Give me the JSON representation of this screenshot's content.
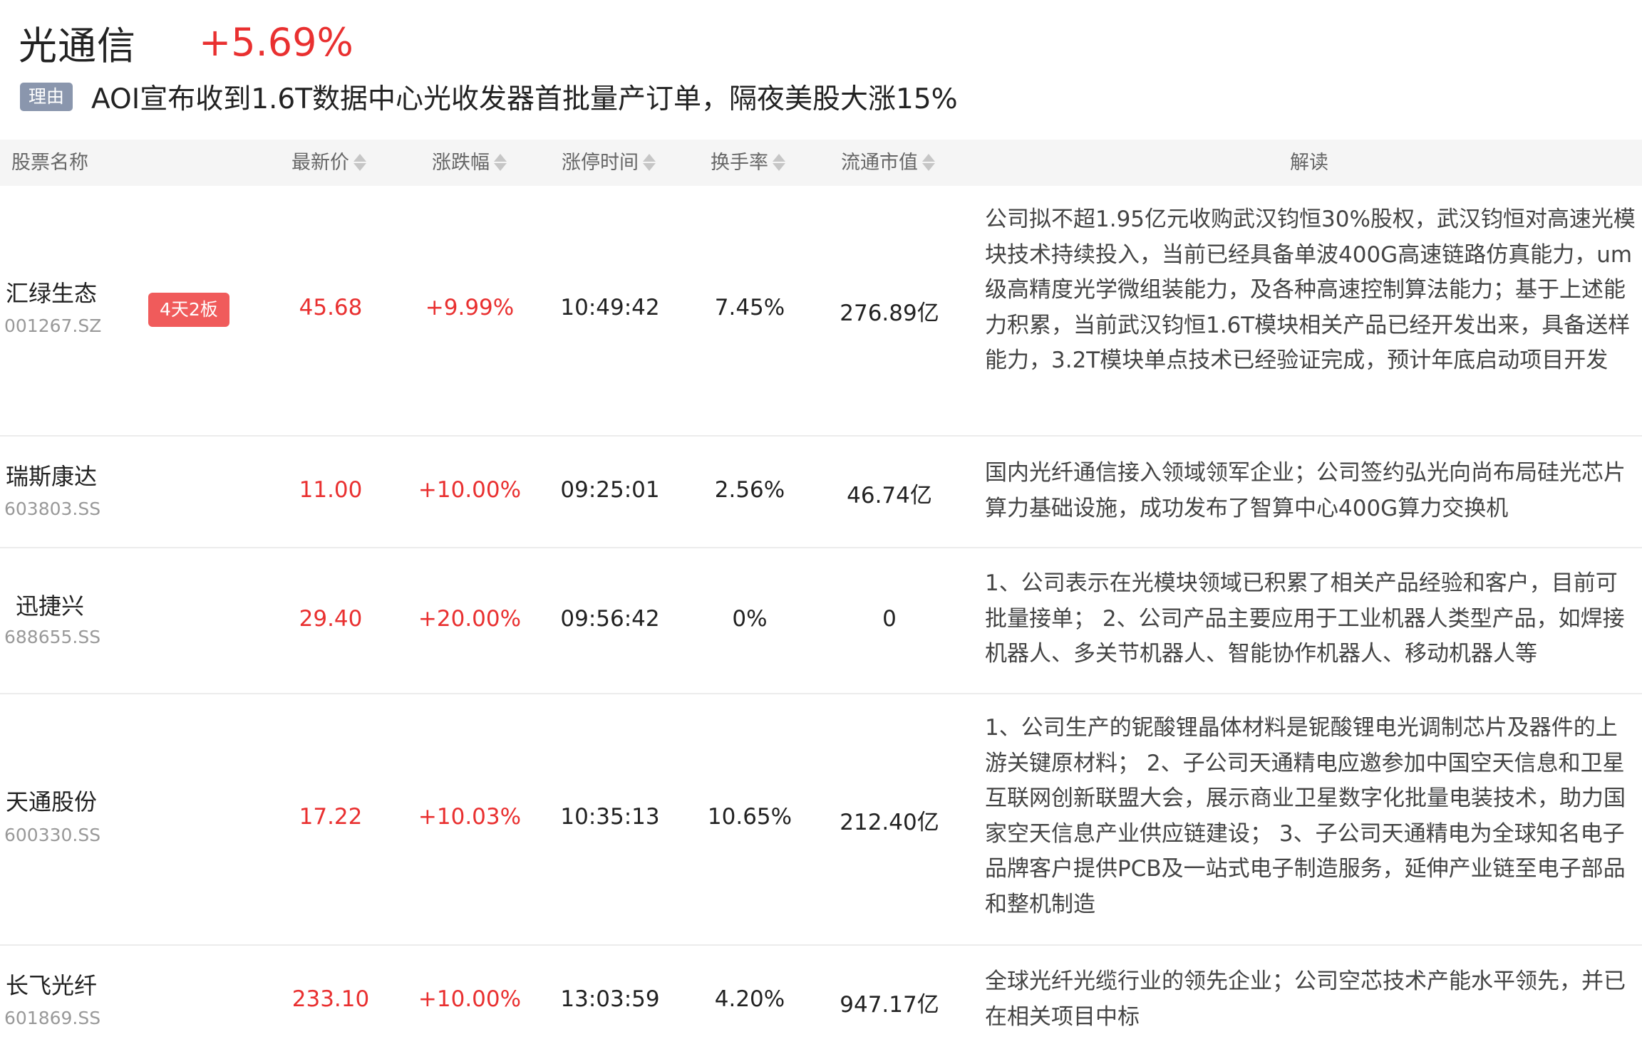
{
  "sector": {
    "name": "光通信",
    "change": "+5.69%"
  },
  "reason": {
    "tag": "理由",
    "text": "AOI宣布收到1.6T数据中心光收发器首批量产订单，隔夜美股大涨15%"
  },
  "table": {
    "headers": {
      "name": "股票名称",
      "price": "最新价",
      "change": "涨跌幅",
      "limit_time": "涨停时间",
      "turnover": "换手率",
      "float_cap": "流通市值",
      "analysis": "解读"
    },
    "rows": [
      {
        "name": "汇绿生态",
        "code": "001267.SZ",
        "badge": "4天2板",
        "price": "45.68",
        "change": "+9.99%",
        "limit_time": "10:49:42",
        "turnover": "7.45%",
        "float_cap": "276.89亿",
        "analysis": "公司拟不超1.95亿元收购武汉钧恒30%股权，武汉钧恒对高速光模块技术持续投入，当前已经具备单波400G高速链路仿真能力，um级高精度光学微组装能力，及各种高速控制算法能力；基于上述能力积累，当前武汉钧恒1.6T模块相关产品已经开发出来，具备送样能力，3.2T模块单点技术已经验证完成，预计年底启动项目开发"
      },
      {
        "name": "瑞斯康达",
        "code": "603803.SS",
        "badge": "",
        "price": "11.00",
        "change": "+10.00%",
        "limit_time": "09:25:01",
        "turnover": "2.56%",
        "float_cap": "46.74亿",
        "analysis": "国内光纤通信接入领域领军企业；公司签约弘光向尚布局硅光芯片算力基础设施，成功发布了智算中心400G算力交换机"
      },
      {
        "name": "迅捷兴",
        "code": "688655.SS",
        "badge": "",
        "price": "29.40",
        "change": "+20.00%",
        "limit_time": "09:56:42",
        "turnover": "0%",
        "float_cap": "0",
        "analysis": "1、公司表示在光模块领域已积累了相关产品经验和客户，目前可批量接单； 2、公司产品主要应用于工业机器人类型产品，如焊接机器人、多关节机器人、智能协作机器人、移动机器人等"
      },
      {
        "name": "天通股份",
        "code": "600330.SS",
        "badge": "",
        "price": "17.22",
        "change": "+10.03%",
        "limit_time": "10:35:13",
        "turnover": "10.65%",
        "float_cap": "212.40亿",
        "analysis": "1、公司生产的铌酸锂晶体材料是铌酸锂电光调制芯片及器件的上游关键原材料； 2、子公司天通精电应邀参加中国空天信息和卫星互联网创新联盟大会，展示商业卫星数字化批量电装技术，助力国家空天信息产业供应链建设； 3、子公司天通精电为全球知名电子品牌客户提供PCB及一站式电子制造服务，延伸产业链至电子部品和整机制造"
      },
      {
        "name": "长飞光纤",
        "code": "601869.SS",
        "badge": "",
        "price": "233.10",
        "change": "+10.00%",
        "limit_time": "13:03:59",
        "turnover": "4.20%",
        "float_cap": "947.17亿",
        "analysis": "全球光纤光缆行业的领先企业；公司空芯技术产能水平领先，并已在相关项目中标"
      }
    ]
  },
  "colors": {
    "up": "#e93030",
    "badge": "#f05b5b",
    "tag": "#8a96ad",
    "header_bg": "#f5f5f5"
  }
}
